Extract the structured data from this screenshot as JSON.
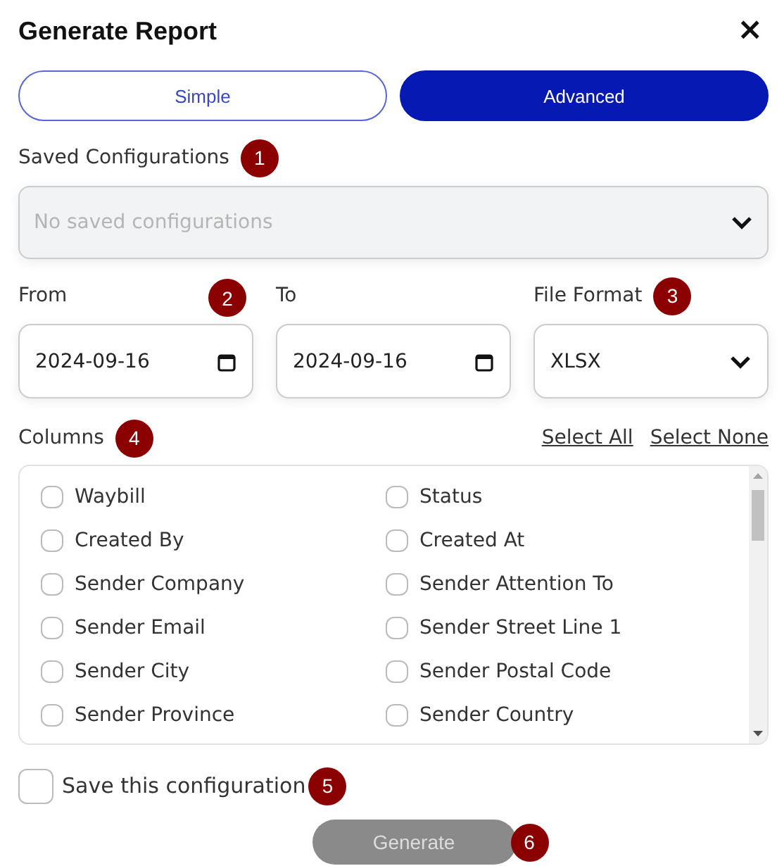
{
  "dialog": {
    "title": "Generate Report",
    "close": "×"
  },
  "tabs": [
    {
      "label": "Simple",
      "selected": false
    },
    {
      "label": "Advanced",
      "selected": true
    }
  ],
  "saved_configurations": {
    "label": "Saved Configurations",
    "badge": "1",
    "placeholder": "No saved configurations",
    "disabled": true
  },
  "from": {
    "label": "From",
    "value": "2024-09-16",
    "badge": "2"
  },
  "to": {
    "label": "To",
    "value": "2024-09-16"
  },
  "file_format": {
    "label": "File Format",
    "value": "XLSX",
    "badge": "3"
  },
  "columns": {
    "label": "Columns",
    "badge": "4",
    "select_all": "Select All",
    "select_none": "Select None",
    "items": [
      {
        "label": "Waybill",
        "checked": false
      },
      {
        "label": "Status",
        "checked": false
      },
      {
        "label": "Created By",
        "checked": false
      },
      {
        "label": "Created At",
        "checked": false
      },
      {
        "label": "Sender Company",
        "checked": false
      },
      {
        "label": "Sender Attention To",
        "checked": false
      },
      {
        "label": "Sender Email",
        "checked": false
      },
      {
        "label": "Sender Street Line 1",
        "checked": false
      },
      {
        "label": "Sender City",
        "checked": false
      },
      {
        "label": "Sender Postal Code",
        "checked": false
      },
      {
        "label": "Sender Province",
        "checked": false
      },
      {
        "label": "Sender Country",
        "checked": false
      }
    ]
  },
  "save_configuration": {
    "label": "Save this configuration",
    "checked": false,
    "badge": "5"
  },
  "generate": {
    "label": "Generate",
    "disabled": true,
    "badge": "6"
  }
}
